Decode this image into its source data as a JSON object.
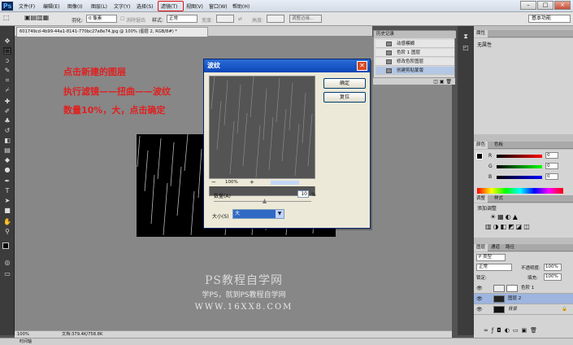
{
  "app": {
    "logo": "Ps"
  },
  "menubar": {
    "items": [
      "文件(F)",
      "编辑(E)",
      "图像(I)",
      "图层(L)",
      "文字(Y)",
      "选择(S)",
      "滤镜(T)",
      "视图(V)",
      "窗口(W)",
      "帮助(H)"
    ],
    "highlighted": "滤镜(T)",
    "highlight_color": "#e01010",
    "window_controls": [
      "–",
      "□",
      "×"
    ]
  },
  "options": {
    "feather_label": "羽化:",
    "feather_value": "0 像素",
    "antialias_label": "消除锯齿",
    "style_label": "样式:",
    "style_value": "正常",
    "width_label": "宽度:",
    "height_label": "高度:",
    "refine_edge": "调整边缘...",
    "workspace": "基本功能"
  },
  "document": {
    "tab_title": "601749cd-4b99-44a1-8141-770bc27a8e74.jpg @ 100% (图层 2, RGB/8#) *",
    "zoom": "100%",
    "doc_size": "文档:379.4K/758.8K",
    "bottom_tab": "时间轴"
  },
  "instructions": [
    "点击新建的图层",
    "执行滤镜——扭曲——波纹",
    "数量10%，大，点击确定"
  ],
  "instruction_color": "#e02020",
  "watermark": {
    "line1": "PS教程自学网",
    "line2": "学PS，就到PS教程自学网",
    "line3": "WWW.16XX8.COM"
  },
  "dialog": {
    "title": "波纹",
    "ok": "确定",
    "reset": "复位",
    "preview_zoom": "100%",
    "amount_label": "数量(A)",
    "amount_value": "10",
    "amount_unit": "%",
    "size_label": "大小(S)",
    "size_value": "大"
  },
  "history": {
    "tab": "历史记录",
    "rows": [
      "动感模糊",
      "色阶 1 图层",
      "修改色阶图层",
      "创建剪贴蒙版"
    ]
  },
  "properties": {
    "tab": "属性",
    "empty": "无属性"
  },
  "color": {
    "tabs": [
      "颜色",
      "色板"
    ],
    "channels": [
      {
        "label": "R",
        "value": "0"
      },
      {
        "label": "G",
        "value": "0"
      },
      {
        "label": "B",
        "value": "0"
      }
    ]
  },
  "adjustments": {
    "tabs": [
      "调整",
      "样式"
    ],
    "add_label": "添加调整"
  },
  "layers": {
    "tabs": [
      "图层",
      "通道",
      "路径"
    ],
    "kind": "P 类型",
    "blend": "正常",
    "opacity_label": "不透明度:",
    "opacity_value": "100%",
    "lock_label": "锁定:",
    "fill_label": "填充:",
    "fill_value": "100%",
    "items": [
      {
        "name": "色阶 1"
      },
      {
        "name": "图层 2"
      },
      {
        "name": "背景"
      }
    ]
  }
}
